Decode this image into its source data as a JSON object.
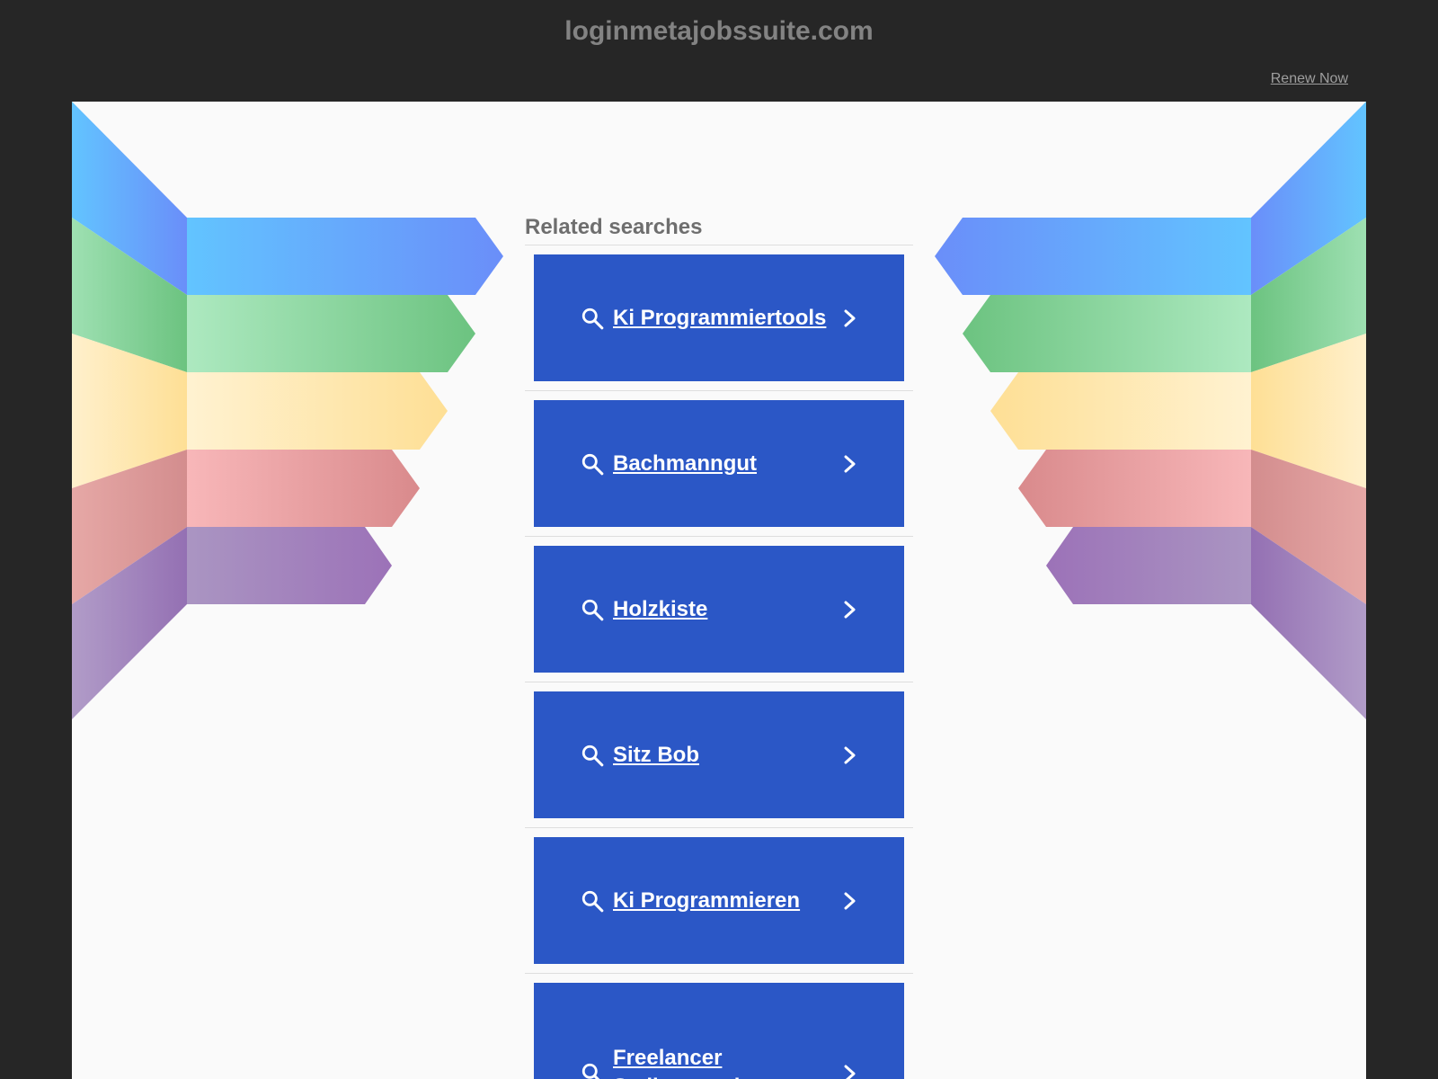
{
  "header": {
    "domain": "loginmetajobssuite.com",
    "renew_label": "Renew Now"
  },
  "related": {
    "heading": "Related searches",
    "items": [
      {
        "label": "Ki Programmiertools"
      },
      {
        "label": "Bachmanngut"
      },
      {
        "label": "Holzkiste"
      },
      {
        "label": "Sitz Bob"
      },
      {
        "label": "Ki Programmieren"
      },
      {
        "label": "Freelancer Stellenangebote"
      }
    ]
  },
  "icons": {
    "search": "search-icon",
    "chevron": "chevron-right-icon"
  },
  "colors": {
    "page_background": "#262626",
    "panel_background": "#fafafa",
    "button_background": "#2b57c6",
    "button_text": "#ffffff",
    "domain_text": "#838383",
    "heading_text": "#6e6e6e"
  }
}
